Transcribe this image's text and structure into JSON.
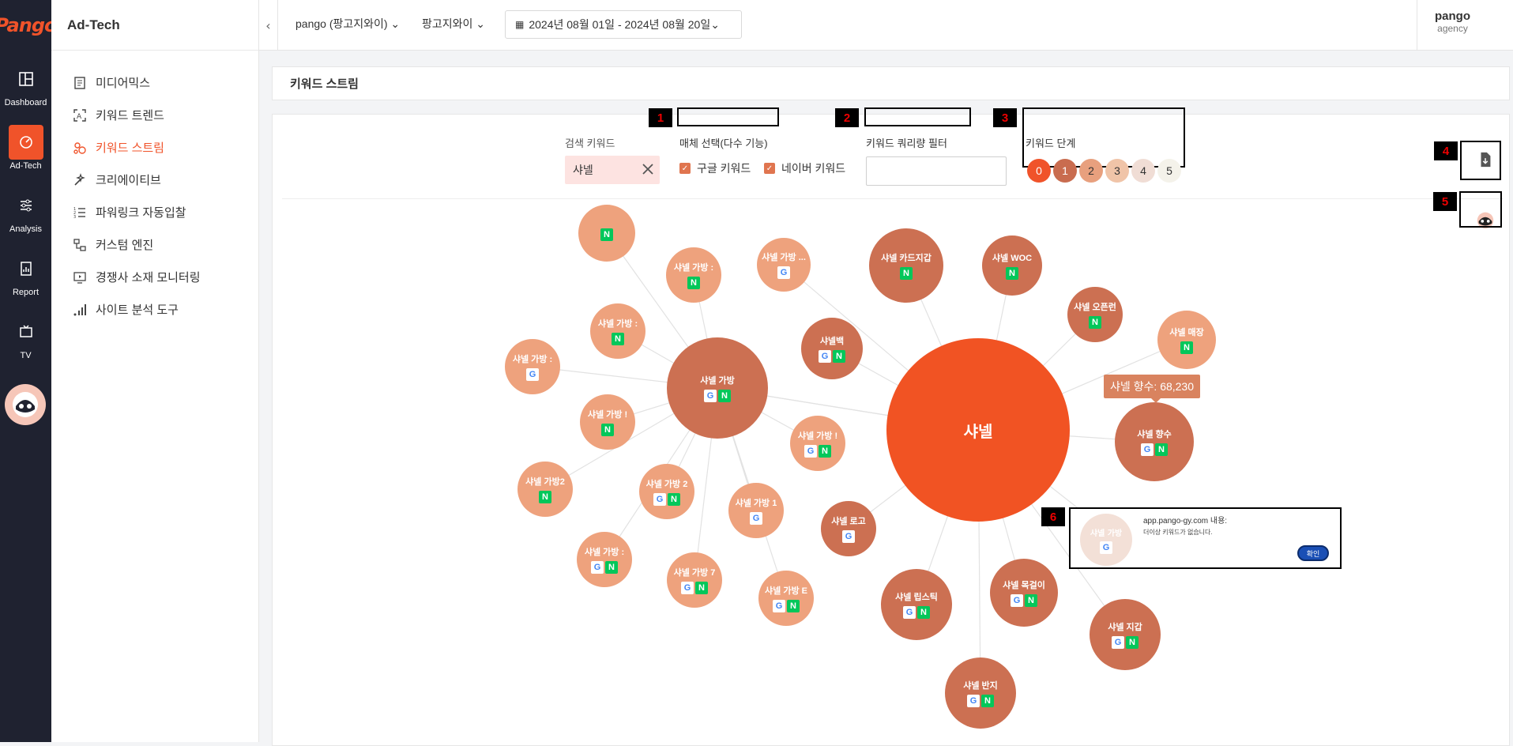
{
  "rail": {
    "logo": "Pango",
    "items": [
      {
        "label": "Dashboard",
        "icon": "layout-icon"
      },
      {
        "label": "Ad-Tech",
        "icon": "gauge-icon"
      },
      {
        "label": "Analysis",
        "icon": "sliders-icon"
      },
      {
        "label": "Report",
        "icon": "report-icon"
      },
      {
        "label": "TV",
        "icon": "tv-icon"
      }
    ]
  },
  "sidebar": {
    "title": "Ad-Tech",
    "items": [
      {
        "label": "미디어믹스"
      },
      {
        "label": "키워드 트렌드"
      },
      {
        "label": "키워드 스트림"
      },
      {
        "label": "크리에이티브"
      },
      {
        "label": "파워링크 자동입찰"
      },
      {
        "label": "커스텀 엔진"
      },
      {
        "label": "경쟁사 소재 모니터링"
      },
      {
        "label": "사이트 분석 도구"
      }
    ]
  },
  "topbar": {
    "account": "pango (팡고지와이)",
    "company": "팡고지와이",
    "date_range": "2024년 08월 01일 - 2024년 08월 20일",
    "user_name": "pango",
    "user_role": "agency"
  },
  "page_title": "키워드 스트림",
  "filters": {
    "search_label": "검색 키워드",
    "search_value": "샤넬",
    "media_label": "매체 선택(다수 기능)",
    "google_label": "구글 키워드",
    "naver_label": "네이버 키워드",
    "query_filter_label": "키워드 쿼리량 필터",
    "stage_label": "키워드 단계",
    "stages": [
      "0",
      "1",
      "2",
      "3",
      "4",
      "5"
    ],
    "stage_colors": [
      "#f0532a",
      "#c96c4f",
      "#e8a07e",
      "#f0c4a8",
      "#f0ddd5",
      "#f4f2ea"
    ]
  },
  "annotations": [
    "1",
    "2",
    "3",
    "4",
    "5",
    "6"
  ],
  "graph": {
    "center": "샤넬",
    "nodes": [
      {
        "label": "",
        "g": false,
        "n": true
      },
      {
        "label": "샤넬 가방 :",
        "g": false,
        "n": true
      },
      {
        "label": "샤넬 가방 ...",
        "g": true,
        "n": false
      },
      {
        "label": "샤넬 카드지갑",
        "g": false,
        "n": true
      },
      {
        "label": "샤넬 WOC",
        "g": false,
        "n": true
      },
      {
        "label": "샤넬 오픈런",
        "g": false,
        "n": true
      },
      {
        "label": "샤넬 매장",
        "g": false,
        "n": true
      },
      {
        "label": "샤넬 가방 :",
        "g": false,
        "n": true
      },
      {
        "label": "샤넬백",
        "g": true,
        "n": true
      },
      {
        "label": "샤넬 가방 :",
        "g": true,
        "n": false
      },
      {
        "label": "샤넬 가방",
        "g": true,
        "n": true
      },
      {
        "label": "샤넬 가방 !",
        "g": false,
        "n": true
      },
      {
        "label": "샤넬 가방 !",
        "g": true,
        "n": true
      },
      {
        "label": "샤넬 향수",
        "g": true,
        "n": true
      },
      {
        "label": "샤넬 가방2",
        "g": false,
        "n": true
      },
      {
        "label": "샤넬 가방 2",
        "g": true,
        "n": true
      },
      {
        "label": "샤넬 가방 1",
        "g": true,
        "n": false
      },
      {
        "label": "샤넬 로고",
        "g": true,
        "n": false
      },
      {
        "label": "샤넬 가방 :",
        "g": true,
        "n": true
      },
      {
        "label": "샤넬 가방 7",
        "g": true,
        "n": true
      },
      {
        "label": "샤넬 가방 E",
        "g": true,
        "n": true
      },
      {
        "label": "샤넬 립스틱",
        "g": true,
        "n": true
      },
      {
        "label": "샤넬 목걸이",
        "g": true,
        "n": true
      },
      {
        "label": "샤넬 지갑",
        "g": true,
        "n": true
      },
      {
        "label": "샤넬 반지",
        "g": true,
        "n": true
      }
    ],
    "tooltip": "샤넬 향수: 68,230",
    "colors": {
      "center": "#f15323",
      "level1": "#cc7052",
      "level2": "#eea27d"
    }
  },
  "dialog": {
    "ghost_label": "샤넬 가방",
    "title": "app.pango-gy.com 내용:",
    "message": "더이상 키워드가 없습니다.",
    "ok": "확인"
  }
}
